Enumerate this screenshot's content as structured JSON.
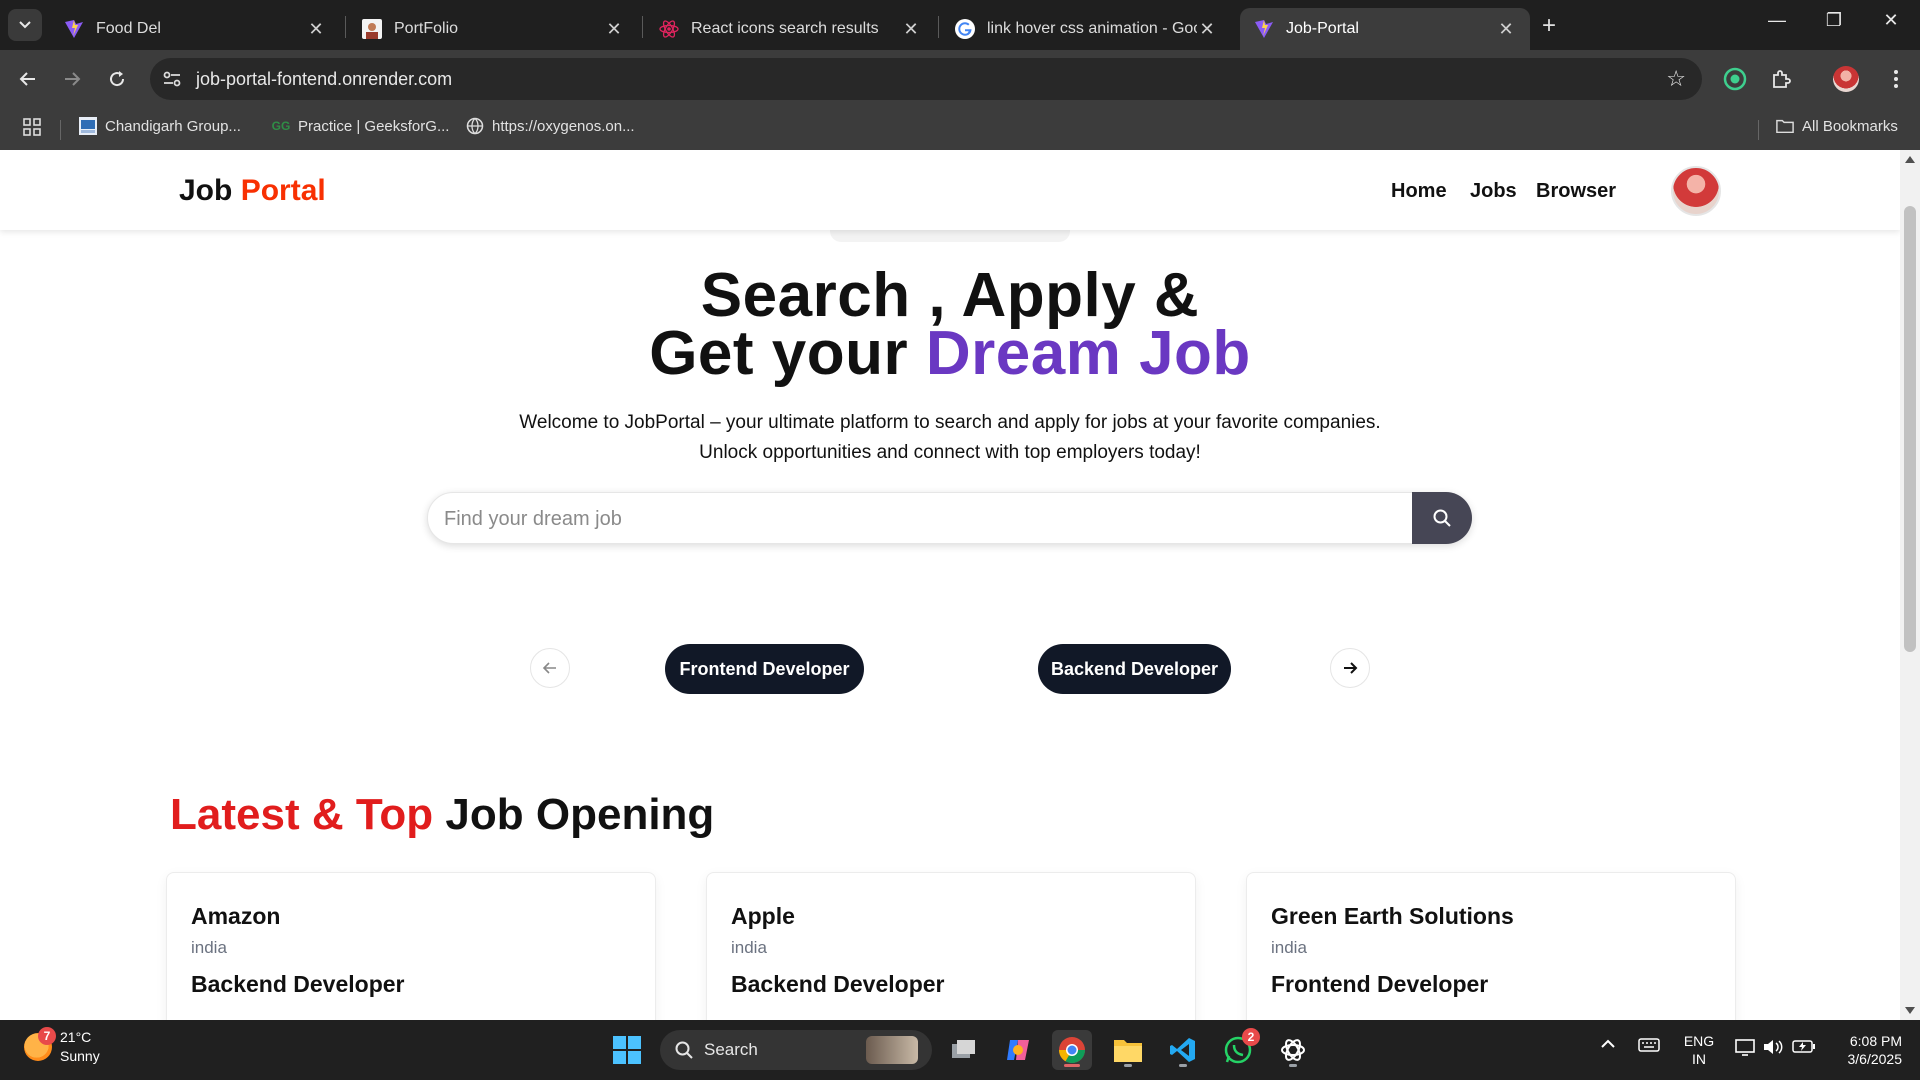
{
  "browser": {
    "tabs": [
      {
        "title": "Food Del",
        "favicon": "vite-icon"
      },
      {
        "title": "PortFolio",
        "favicon": "portrait-icon"
      },
      {
        "title": "React icons search results",
        "favicon": "react-icon"
      },
      {
        "title": "link hover css animation - Goog",
        "favicon": "google-icon"
      },
      {
        "title": "Job-Portal",
        "favicon": "vite-icon"
      }
    ],
    "active_tab": "Job-Portal",
    "url": "job-portal-fontend.onrender.com",
    "bookmarks": [
      {
        "label": "Chandigarh Group..."
      },
      {
        "label": "Practice | GeeksforG..."
      },
      {
        "label": "https://oxygenos.on..."
      }
    ],
    "all_bookmarks_label": "All Bookmarks"
  },
  "site": {
    "logo_part1": "Job",
    "logo_part2": "Portal",
    "nav": [
      "Home",
      "Jobs",
      "Browser"
    ],
    "hero": {
      "line1": "Search , Apply &",
      "line2_prefix": "Get your",
      "line2_highlight": "Dream Job",
      "sub_line1": "Welcome to JobPortal – your ultimate platform to search and apply for jobs at your favorite companies.",
      "sub_line2": "Unlock opportunities and connect with top employers today!"
    },
    "search": {
      "placeholder": "Find your dream job",
      "value": ""
    },
    "categories": [
      "Frontend Developer",
      "Backend Developer"
    ],
    "section": {
      "title_highlight": "Latest & Top",
      "title_rest": "Job Opening"
    },
    "jobs": [
      {
        "company": "Amazon",
        "location": "india",
        "role": "Backend Developer"
      },
      {
        "company": "Apple",
        "location": "india",
        "role": "Backend Developer"
      },
      {
        "company": "Green Earth Solutions",
        "location": "india",
        "role": "Frontend Developer"
      }
    ]
  },
  "taskbar": {
    "weather": {
      "temp": "21°C",
      "condition": "Sunny",
      "badge": "7"
    },
    "search_label": "Search",
    "whatsapp_badge": "2",
    "lang_line1": "ENG",
    "lang_line2": "IN",
    "time": "6:08 PM",
    "date": "3/6/2025"
  },
  "colors": {
    "brand_red": "#f83002",
    "purple": "#6a38c2",
    "section_red": "#e11d1d",
    "chip_bg": "#111827"
  }
}
